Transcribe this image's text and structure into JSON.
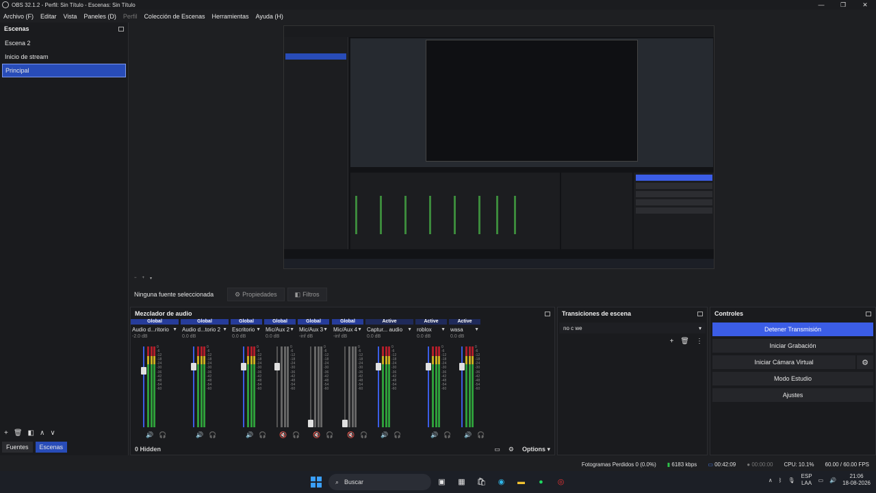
{
  "window": {
    "title": "OBS 32.1.2 - Perfil: Sin Título - Escenas: Sin Título"
  },
  "menu": [
    {
      "label": "Archivo (F)",
      "dim": false
    },
    {
      "label": "Editar",
      "dim": false
    },
    {
      "label": "Vista",
      "dim": false
    },
    {
      "label": "Paneles (D)",
      "dim": false
    },
    {
      "label": "Perfil",
      "dim": true
    },
    {
      "label": "Colección de Escenas",
      "dim": false
    },
    {
      "label": "Herramientas",
      "dim": false
    },
    {
      "label": "Ayuda (H)",
      "dim": false
    }
  ],
  "scenes": {
    "title": "Escenas",
    "items": [
      "Escena 2",
      "Inicio de stream",
      "Principal"
    ],
    "selected": "Principal",
    "tabs": {
      "sources": "Fuentes",
      "scenes": "Escenas"
    }
  },
  "source_bar": {
    "no_selection": "Ninguna fuente seleccionada",
    "properties": "Propiedades",
    "filters": "Filtros"
  },
  "mixer": {
    "title": "Mezclador de audio",
    "channels": [
      {
        "scope": "Global",
        "name": "Audio d...ritorio",
        "db": "-2.0 dB",
        "level": 0.72,
        "active": true,
        "muted": false
      },
      {
        "scope": "Global",
        "name": "Audio d...torio 2",
        "db": "0.0 dB",
        "level": 0.78,
        "active": true,
        "muted": false
      },
      {
        "scope": "Global",
        "name": "Escritorio",
        "db": "0.0 dB",
        "level": 0.78,
        "active": true,
        "muted": false
      },
      {
        "scope": "Global",
        "name": "Mic/Aux 2",
        "db": "0.0 dB",
        "level": 0.78,
        "active": false,
        "muted": true
      },
      {
        "scope": "Global",
        "name": "Mic/Aux 3",
        "db": "-inf dB",
        "level": 0.0,
        "active": false,
        "muted": true
      },
      {
        "scope": "Global",
        "name": "Mic/Aux 4",
        "db": "-inf dB",
        "level": 0.0,
        "active": false,
        "muted": true
      },
      {
        "scope": "Active",
        "name": "Captur... audio",
        "db": "0.0 dB",
        "level": 0.78,
        "active": true,
        "muted": false
      },
      {
        "scope": "Active",
        "name": "roblox",
        "db": "0.0 dB",
        "level": 0.78,
        "active": true,
        "muted": false
      },
      {
        "scope": "Active",
        "name": "wasa",
        "db": "0.0 dB",
        "level": 0.78,
        "active": true,
        "muted": false
      }
    ],
    "scale": [
      "0",
      "-6",
      "-12",
      "-18",
      "-24",
      "-30",
      "-36",
      "-42",
      "-48",
      "-54",
      "-60"
    ],
    "hidden_count": "0 Hidden",
    "options": "Options"
  },
  "transitions": {
    "title": "Transiciones de escena",
    "selected": "no c we"
  },
  "controls": {
    "title": "Controles",
    "stop_stream": "Detener Transmisión",
    "start_recording": "Iniciar Grabación",
    "start_virtual_cam": "Iniciar Cámara Virtual",
    "studio_mode": "Modo Estudio",
    "settings": "Ajustes"
  },
  "status": {
    "dropped": "Fotogramas Perdidos 0 (0.0%)",
    "bitrate": "6183 kbps",
    "stream_time": "00:42:09",
    "rec_time": "00:00:00",
    "cpu": "CPU: 10.1%",
    "fps": "60.00 / 60.00 FPS"
  },
  "taskbar": {
    "search": "Buscar",
    "lang_top": "ESP",
    "lang_bottom": "LAA",
    "time": "21:06",
    "date": "18-08-2026"
  },
  "colors": {
    "accent": "#3b5de6",
    "selection": "#284cb8",
    "meter_green": "#2e9e3a",
    "meter_red": "#b01e2a"
  }
}
